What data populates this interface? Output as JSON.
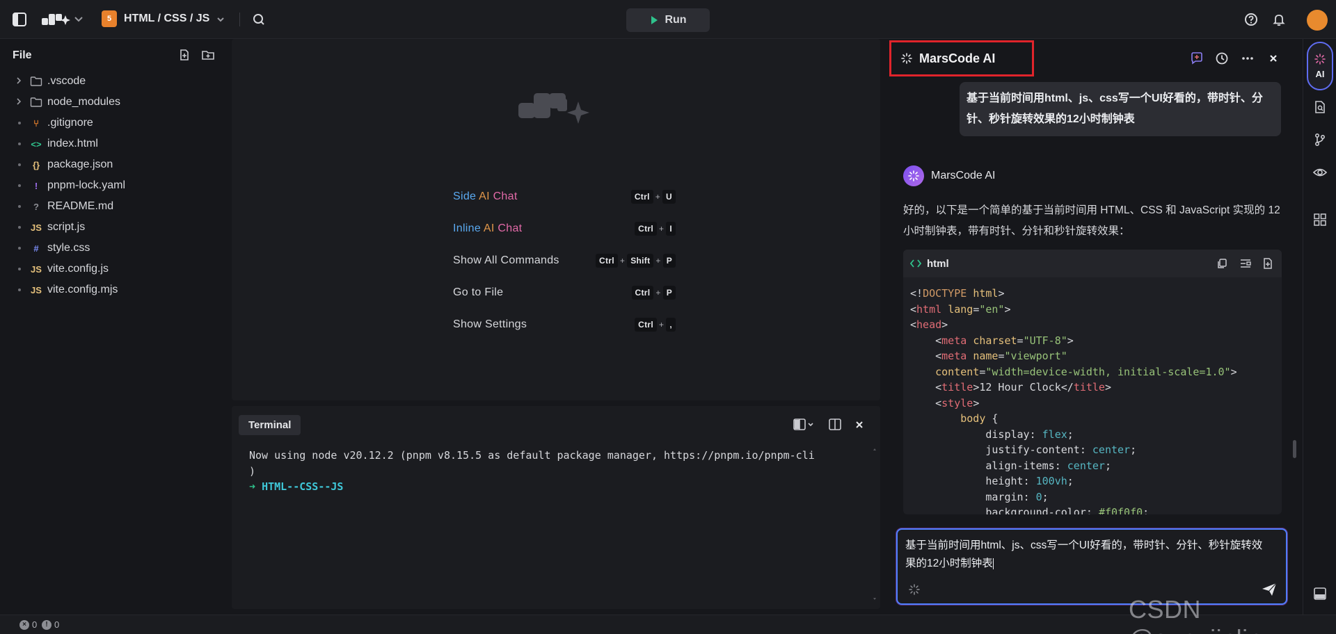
{
  "topbar": {
    "project_badge": "5",
    "project_name": "HTML / CSS / JS",
    "run_label": "Run"
  },
  "explorer": {
    "title": "File",
    "items": [
      {
        "name": ".vscode",
        "type": "folder",
        "icon": "folder-icon"
      },
      {
        "name": "node_modules",
        "type": "folder",
        "icon": "folder-icon"
      },
      {
        "name": ".gitignore",
        "type": "file",
        "icon": "git-icon",
        "glyph": "⑂",
        "color": "#e8812c"
      },
      {
        "name": "index.html",
        "type": "file",
        "icon": "html-code-icon",
        "glyph": "<>",
        "color": "#2fc28c"
      },
      {
        "name": "package.json",
        "type": "file",
        "icon": "json-braces-icon",
        "glyph": "{}",
        "color": "#e5c07b"
      },
      {
        "name": "pnpm-lock.yaml",
        "type": "file",
        "icon": "exclamation-icon",
        "glyph": "!",
        "color": "#a070f0"
      },
      {
        "name": "README.md",
        "type": "file",
        "icon": "question-circle-icon",
        "glyph": "?",
        "color": "#8d8e94"
      },
      {
        "name": "script.js",
        "type": "file",
        "icon": "js-icon",
        "glyph": "JS",
        "color": "#e5c07b"
      },
      {
        "name": "style.css",
        "type": "file",
        "icon": "hash-icon",
        "glyph": "#",
        "color": "#7a8cf5"
      },
      {
        "name": "vite.config.js",
        "type": "file",
        "icon": "js-icon",
        "glyph": "JS",
        "color": "#e5c07b"
      },
      {
        "name": "vite.config.mjs",
        "type": "file",
        "icon": "js-icon",
        "glyph": "JS",
        "color": "#e5c07b"
      }
    ]
  },
  "welcome": {
    "shortcuts": [
      {
        "label": [
          {
            "t": "Side",
            "c": "c-blue"
          },
          {
            "t": " AI",
            "c": "c-orange"
          },
          {
            "t": " Chat",
            "c": "c-pink"
          }
        ],
        "keys": [
          "Ctrl",
          "U"
        ]
      },
      {
        "label": [
          {
            "t": "Inline",
            "c": "c-blue"
          },
          {
            "t": " AI",
            "c": "c-orange"
          },
          {
            "t": " Chat",
            "c": "c-pink"
          }
        ],
        "keys": [
          "Ctrl",
          "I"
        ]
      },
      {
        "label": [
          {
            "t": "Show All Commands",
            "c": ""
          }
        ],
        "keys": [
          "Ctrl",
          "Shift",
          "P"
        ]
      },
      {
        "label": [
          {
            "t": "Go to File",
            "c": ""
          }
        ],
        "keys": [
          "Ctrl",
          "P"
        ]
      },
      {
        "label": [
          {
            "t": "Show Settings",
            "c": ""
          }
        ],
        "keys": [
          "Ctrl",
          ","
        ]
      }
    ]
  },
  "terminal": {
    "tab_label": "Terminal",
    "line1": "Now using node v20.12.2 (pnpm v8.15.5 as default package manager, https://pnpm.io/pnpm-cli",
    "line2": ")",
    "prompt_arrow": "➜",
    "prompt_dir": "HTML--CSS--JS"
  },
  "ai": {
    "title": "MarsCode AI",
    "user_message": "基于当前时间用html、js、css写一个UI好看的，带时针、分针、秒针旋转效果的12小时制钟表",
    "bot_name": "MarsCode AI",
    "bot_text": "好的，以下是一个简单的基于当前时间用 HTML、CSS 和 JavaScript 实现的 12 小时制钟表，带有时针、分针和秒针旋转效果：",
    "code_lang": "html",
    "input_text": "基于当前时间用html、js、css写一个UI好看的，带时针、分针、秒针旋转效果的12小时制钟表"
  },
  "rail": {
    "ai_label": "AI"
  },
  "status": {
    "errors": "0",
    "warnings": "0"
  },
  "watermark": "CSDN @sun_jinlin",
  "colors": {
    "accent_red_outline": "#e0242b",
    "input_border": "#4f7fff",
    "terminal_prompt": "#2fc28c"
  }
}
